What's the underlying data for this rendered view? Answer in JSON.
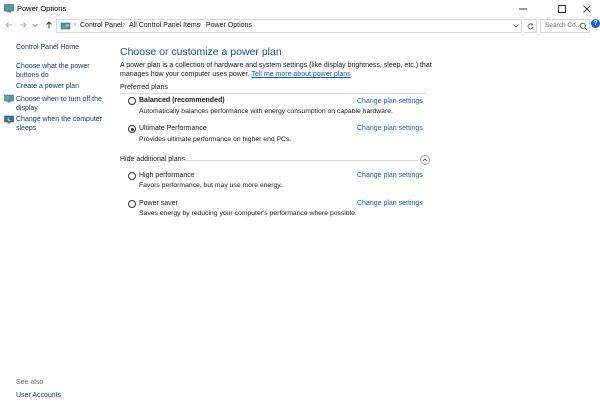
{
  "window": {
    "title": "Power Options"
  },
  "address": {
    "breadcrumbs": [
      "Control Panel",
      "All Control Panel Items",
      "Power Options"
    ],
    "search_placeholder": "Search Co..."
  },
  "sidebar": {
    "home": "Control Panel Home",
    "links": [
      {
        "label": "Choose what the power buttons do",
        "icon": "none"
      },
      {
        "label": "Create a power plan",
        "icon": "none"
      },
      {
        "label": "Choose when to turn off the display",
        "icon": "monitor-icon"
      },
      {
        "label": "Change when the computer sleeps",
        "icon": "moon-icon"
      }
    ],
    "see_also_title": "See also",
    "see_also": [
      {
        "label": "User Accounts"
      }
    ]
  },
  "main": {
    "heading": "Choose or customize a power plan",
    "description": "A power plan is a collection of hardware and system settings (like display brightness, sleep, etc.) that manages how your computer uses power.",
    "description_link": "Tell me more about power plans",
    "preferred_label": "Preferred plans",
    "hidden_label": "Hide additional plans",
    "change_link": "Change plan settings",
    "preferred_plans": [
      {
        "name": "Balanced (recommended)",
        "desc": "Automatically balances performance with energy consumption on capable hardware.",
        "selected": false,
        "bold": true
      },
      {
        "name": "Ultimate Performance",
        "desc": "Provides ultimate performance on higher end PCs.",
        "selected": true,
        "bold": false
      }
    ],
    "additional_plans": [
      {
        "name": "High performance",
        "desc": "Favors performance, but may use more energy.",
        "selected": false
      },
      {
        "name": "Power saver",
        "desc": "Saves energy by reducing your computer's performance where possible.",
        "selected": false
      }
    ]
  },
  "colors": {
    "heading": "#1e4e8c",
    "link": "#1764c0",
    "sidebar_link": "#1a3d6b"
  }
}
